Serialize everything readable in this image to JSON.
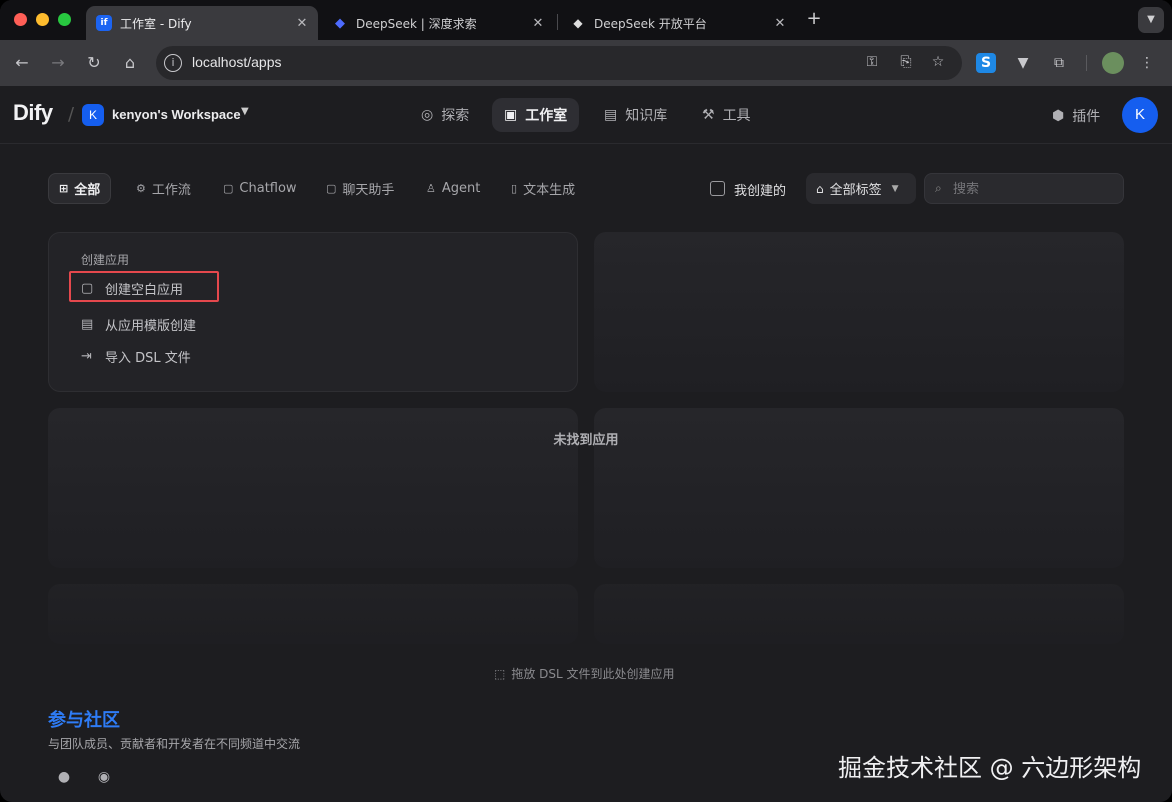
{
  "browser": {
    "tabs": [
      {
        "title": "工作室 - Dify",
        "favicon": "dify-favicon",
        "active": true
      },
      {
        "title": "DeepSeek | 深度求索",
        "favicon": "deepseek-favicon",
        "active": false
      },
      {
        "title": "DeepSeek 开放平台",
        "favicon": "deepseek-platform-favicon",
        "active": false
      }
    ],
    "url": "localhost/apps"
  },
  "header": {
    "logo": "Dify",
    "workspace": {
      "initial": "K",
      "name": "kenyon's Workspace"
    },
    "nav": [
      {
        "label": "探索",
        "icon": "compass-icon",
        "active": false
      },
      {
        "label": "工作室",
        "icon": "robot-icon",
        "active": true
      },
      {
        "label": "知识库",
        "icon": "book-icon",
        "active": false
      },
      {
        "label": "工具",
        "icon": "hammer-icon",
        "active": false
      }
    ],
    "plugin_label": "插件",
    "avatar_initial": "K"
  },
  "filters": {
    "tabs": [
      {
        "label": "全部",
        "active": true
      },
      {
        "label": "工作流",
        "active": false
      },
      {
        "label": "Chatflow",
        "active": false
      },
      {
        "label": "聊天助手",
        "active": false
      },
      {
        "label": "Agent",
        "active": false
      },
      {
        "label": "文本生成",
        "active": false
      }
    ],
    "mine_label": "我创建的",
    "tags_label": "全部标签",
    "search_placeholder": "搜索"
  },
  "create": {
    "title": "创建应用",
    "items": [
      {
        "label": "创建空白应用",
        "icon": "file-plus-icon"
      },
      {
        "label": "从应用模版创建",
        "icon": "template-icon"
      },
      {
        "label": "导入 DSL 文件",
        "icon": "import-icon"
      }
    ]
  },
  "empty_text": "未找到应用",
  "drop_hint": "拖放 DSL 文件到此处创建应用",
  "community": {
    "title": "参与社区",
    "subtitle": "与团队成员、贡献者和开发者在不同频道中交流"
  },
  "watermark": "掘金技术社区 @ 六边形架构",
  "colors": {
    "accent": "#155eef",
    "link": "#2e7cf6",
    "highlight": "#e5484d"
  }
}
